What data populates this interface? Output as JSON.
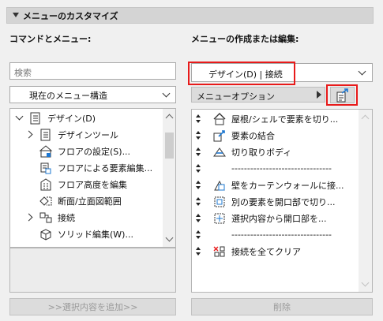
{
  "section": {
    "title": "メニューのカスタマイズ"
  },
  "left": {
    "header": "コマンドとメニュー:",
    "search": {
      "placeholder": "検索",
      "value": ""
    },
    "structure_select": "現在のメニュー構造",
    "tree": [
      {
        "label": "デザイン(D)",
        "icon": "menu-list-icon",
        "expander": "chevron-down"
      },
      {
        "label": "デザインツール",
        "icon": "menu-list-icon",
        "expander": "chevron-right"
      },
      {
        "label": "フロアの設定(S)...",
        "icon": "floor-settings-icon",
        "expander": ""
      },
      {
        "label": "フロアによる要素編集...",
        "icon": "floor-edit-icon",
        "expander": ""
      },
      {
        "label": "フロア高度を編集",
        "icon": "building-height-icon",
        "expander": ""
      },
      {
        "label": "断面/立面図範囲",
        "icon": "section-range-icon",
        "expander": ""
      },
      {
        "label": "接続",
        "icon": "connect-icon",
        "expander": "chevron-right"
      },
      {
        "label": "ソリッド編集(W)...",
        "icon": "solid-edit-icon",
        "expander": ""
      }
    ],
    "add_button": ">>選択内容を追加>>"
  },
  "right": {
    "header": "メニューの作成または編集:",
    "menu_select": "デザイン(D) | 接続",
    "options_button": "メニューオプション",
    "items": [
      {
        "label": "屋根/シェルで要素を切り...",
        "icon": "roof-trim-icon"
      },
      {
        "label": "要素の結合",
        "icon": "merge-elements-icon"
      },
      {
        "label": "切り取りボディ",
        "icon": "cut-body-icon"
      },
      {
        "label": "--------------------------------",
        "icon": ""
      },
      {
        "label": "壁をカーテンウォールに接...",
        "icon": "curtain-wall-icon"
      },
      {
        "label": "別の要素を開口部で切り...",
        "icon": "opening-cut-icon"
      },
      {
        "label": "選択内容から開口部を...",
        "icon": "opening-from-selection-icon"
      },
      {
        "label": "--------------------------------",
        "icon": ""
      },
      {
        "label": "接続を全てクリア",
        "icon": "clear-connections-icon"
      }
    ],
    "delete_button": "削除"
  },
  "colors": {
    "highlight": "#e81a1a",
    "accent_blue": "#1e78d2"
  }
}
